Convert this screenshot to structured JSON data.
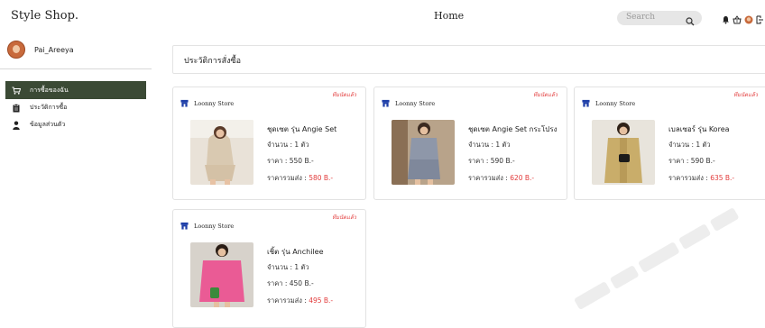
{
  "header": {
    "brand": "Style Shop.",
    "nav_home": "Home",
    "search_placeholder": "Search"
  },
  "sidebar": {
    "username": "Pai_Areeya",
    "items": [
      {
        "label": "การซื้อของฉัน",
        "icon": "cart-icon",
        "active": true
      },
      {
        "label": "ประวัติการซื้อ",
        "icon": "clipboard-icon",
        "active": false
      },
      {
        "label": "ข้อมูลส่วนตัว",
        "icon": "user-icon",
        "active": false
      }
    ]
  },
  "main": {
    "title": "ประวัติการสั่งซื้อ",
    "orders": [
      {
        "status": "ทีมนัดแล้ว",
        "store": "Loonny Store",
        "name": "ชุดเซต รุ่น Angie Set",
        "qty": "จำนวน : 1 ตัว",
        "price": "ราคา : 550 B.-",
        "total_label": "ราคารวมส่ง : ",
        "total_value": "580 B.-"
      },
      {
        "status": "ทีมนัดแล้ว",
        "store": "Loonny Store",
        "name": "ชุดเซต Angie Set กระโปรง",
        "qty": "จำนวน : 1 ตัว",
        "price": "ราคา : 590 B.-",
        "total_label": "ราคารวมส่ง : ",
        "total_value": "620 B.-"
      },
      {
        "status": "ทีมนัดแล้ว",
        "store": "Loonny Store",
        "name": "เบลเซอร์ รุ่น Korea",
        "qty": "จำนวน : 1 ตัว",
        "price": "ราคา : 590 B.-",
        "total_label": "ราคารวมส่ง : ",
        "total_value": "635 B.-"
      },
      {
        "status": "ทีมนัดแล้ว",
        "store": "Loonny Store",
        "name": "เชิ้ต รุ่น Anchilee",
        "qty": "จำนวน : 1 ตัว",
        "price": "ราคา : 450 B.-",
        "total_label": "ราคารวมส่ง : ",
        "total_value": "495 B.-"
      }
    ]
  },
  "colors": {
    "accent_dark_green": "#3b4a35",
    "price_red": "#e23b3b",
    "store_icon_blue": "#1f3fa8"
  }
}
